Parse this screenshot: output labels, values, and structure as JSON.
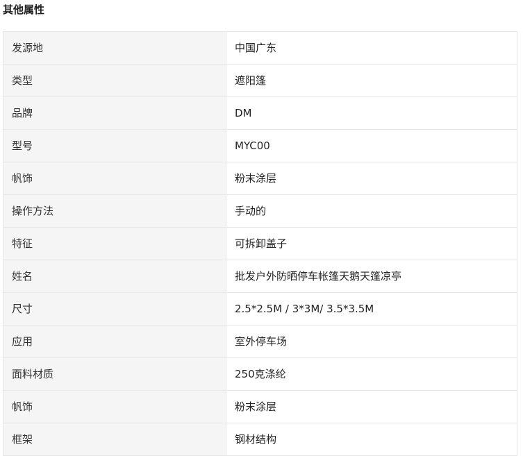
{
  "section": {
    "title": "其他属性"
  },
  "attributes": [
    {
      "key": "发源地",
      "value": "中国广东"
    },
    {
      "key": "类型",
      "value": "遮阳篷"
    },
    {
      "key": "品牌",
      "value": "DM"
    },
    {
      "key": "型号",
      "value": "MYC00"
    },
    {
      "key": "帆饰",
      "value": "粉末涂层"
    },
    {
      "key": "操作方法",
      "value": "手动的"
    },
    {
      "key": "特征",
      "value": "可拆卸盖子"
    },
    {
      "key": "姓名",
      "value": "批发户外防晒停车帐篷天鹅天篷凉亭"
    },
    {
      "key": "尺寸",
      "value": "2.5*2.5M / 3*3M/ 3.5*3.5M"
    },
    {
      "key": "应用",
      "value": "室外停车场"
    },
    {
      "key": "面料材质",
      "value": "250克涤纶"
    },
    {
      "key": "帆饰",
      "value": "粉末涂层"
    },
    {
      "key": "框架",
      "value": "钢材结构"
    }
  ]
}
